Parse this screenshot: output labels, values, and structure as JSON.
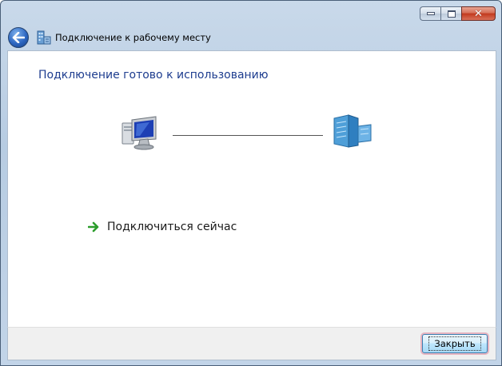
{
  "window": {
    "title": "Подключение к рабочему месту",
    "controls": {
      "minimize": "minimize-icon",
      "maximize": "maximize-icon",
      "close": "close-icon"
    }
  },
  "wizard": {
    "back_icon": "back-arrow-icon",
    "title_icon": "network-workplace-icon",
    "instruction": "Подключение готово к использованию",
    "diagram": {
      "left_icon": "computer-icon",
      "right_icon": "server-building-icon"
    },
    "connect_link": {
      "icon": "green-arrow-icon",
      "label": "Подключиться сейчас"
    }
  },
  "footer": {
    "close_label": "Закрыть"
  },
  "colors": {
    "instruction": "#1e3d8f",
    "link_arrow": "#2c9d2c"
  }
}
